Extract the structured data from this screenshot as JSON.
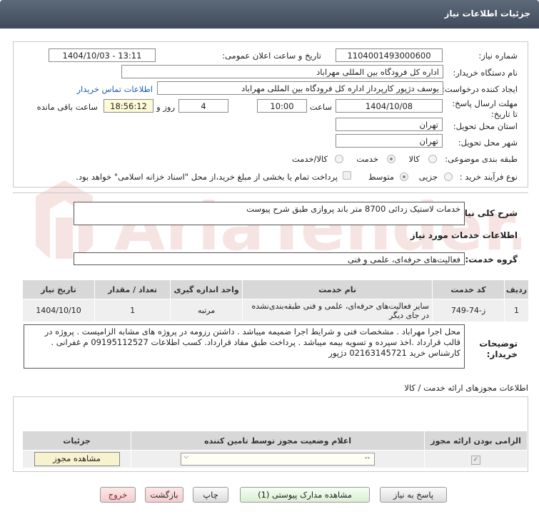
{
  "header": {
    "title": "جزئیات اطلاعات نیاز"
  },
  "need_info": {
    "need_number_label": "شماره نیاز:",
    "need_number": "1104001493000600",
    "announce_label": "تاریخ و ساعت اعلان عمومی:",
    "announce_value": "1404/10/03 - 13:11",
    "buyer_org_label": "نام دستگاه خریدار:",
    "buyer_org": "اداره کل فرودگاه بین المللی مهراباد",
    "creator_label": "ایجاد کننده درخواست:",
    "creator": "یوسف دژپور کارپرداز اداره کل فرودگاه بین المللی مهراباد",
    "contact_link": "اطلاعات تماس خریدار",
    "deadline_label": "مهلت ارسال پاسخ: تا تاریخ:",
    "deadline_date": "1404/10/08",
    "time_label": "ساعت",
    "deadline_time": "10:00",
    "days_value": "4",
    "days_label": "روز و",
    "remaining_time": "18:56:12",
    "remaining_label": "ساعت باقی مانده",
    "province_label": "استان محل تحویل:",
    "province": "تهران",
    "city_label": "شهر محل تحویل:",
    "city": "تهران",
    "category_label": "طبقه بندی موضوعی:",
    "category_options": [
      "کالا",
      "خدمت",
      "کالا/خدمت"
    ],
    "category_selected": "خدمت",
    "process_label": "نوع فرآیند خرید :",
    "process_options": [
      "جزیی",
      "متوسط"
    ],
    "process_selected": "متوسط",
    "payment_note": "پرداخت تمام یا بخشی از مبلغ خرید،از محل \"اسناد خزانه اسلامی\" خواهد بود."
  },
  "summary": {
    "label": "شرح کلی نیاز:",
    "value": "خدمات لاستیک زدائی 8700 متر باند پروازی طبق شرح پیوست"
  },
  "services": {
    "section_title": "اطلاعات خدمات مورد نیاز",
    "group_label": "گروه خدمت:",
    "group_value": "فعالیت‌های حرفه‌ای، علمی و فنی",
    "table": {
      "headers": [
        "ردیف",
        "کد خدمت",
        "نام خدمت",
        "واحد اندازه گیری",
        "تعداد / مقدار",
        "تاریخ نیاز"
      ],
      "rows": [
        [
          "1",
          "ز-74-749",
          "سایر فعالیت‌های حرفه‌ای، علمی و فنی طبقه‌بندی‌نشده در جای دیگر",
          "مرتبه",
          "1",
          "1404/10/10"
        ]
      ]
    }
  },
  "buyer_notes": {
    "label": "توضیحات خریدار:",
    "text": "محل اجرا مهراباد . مشخصات فنی و شرایط اجرا ضمیمه میباشد . داشتن رزومه در پروژه های مشابه الزامیست . پروژه در قالب قرارداد .اخذ سپرده و تسویه بیمه میباشد . پرداخت طبق مفاد قرارداد. کسب اطلاعات 09195112527 م غفرانی . کارشناس خرید 02163145721 دژپور"
  },
  "permits": {
    "title": "اطلاعات مجوزهای ارائه خدمت / کالا",
    "headers": [
      "الزامی بودن ارائه مجوز",
      "اعلام وضعیت مجوز توسط تامین کننده",
      "جزئیات"
    ],
    "select_value": "--",
    "view_button": "مشاهده مجوز"
  },
  "footer_buttons": {
    "reply": "پاسخ به نیاز",
    "attachments": "مشاهده مدارک پیوستی (1)",
    "print": "چاپ",
    "back": "بازگشت",
    "exit": "خروج"
  },
  "watermark": {
    "text": "AriaTender.net"
  },
  "colors": {
    "header": "#4d5a6a",
    "link": "#1a5ab5",
    "remaining_bg": "#fffbd6",
    "watermark": "#c0392b"
  }
}
